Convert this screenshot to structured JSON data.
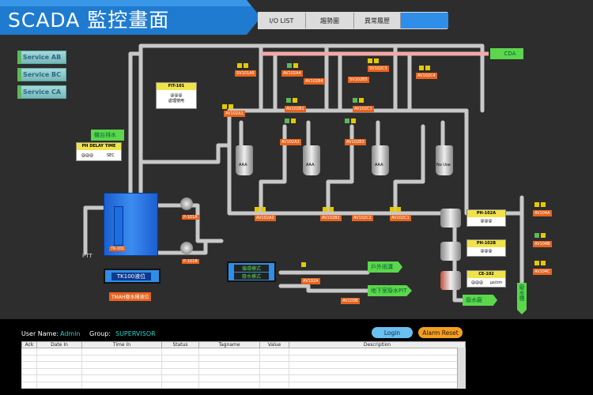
{
  "header": {
    "title": "SCADA 監控畫面",
    "nav_tabs": [
      "I/O LIST",
      "趨勢圖",
      "異常履歷"
    ]
  },
  "services": [
    "Service AB",
    "Service BC",
    "Service CA"
  ],
  "cda_label": "CDA",
  "flow_panel": {
    "title": "FIT-101",
    "value": "@@@",
    "unit": "處理使用",
    "unit2": ""
  },
  "ph_delay": {
    "title": "PH DELAY TIME",
    "value": "@@@",
    "unit": "SEC"
  },
  "machine_drain": "機台排水",
  "main_tank_label": "TK-101",
  "level_box_label": "TK100液位",
  "tmah_label": "TMAH廢水桶液位",
  "pumps": [
    "P-101A",
    "P-101B"
  ],
  "ptt_label": "PTT",
  "filter_labels": [
    "AAA",
    "AAA",
    "AAA",
    "No Use"
  ],
  "valves": {
    "top": [
      "SV101A5",
      "AV102A4",
      "AV102B4",
      "SV102B5",
      "SV102C5",
      "AV102C4"
    ],
    "mid": [
      "AV102A1",
      "AV102B1",
      "AV102C1"
    ],
    "mid2": [
      "AV102A3",
      "AV102B3",
      "AV102C3"
    ],
    "bottom": [
      "AV102A2",
      "AV102B2",
      "AV102C2",
      "AV102C1"
    ],
    "right": [
      "AV104A",
      "AV104B",
      "AV104C"
    ],
    "lower": [
      "AV102A",
      "AV103B"
    ]
  },
  "ph_a": {
    "title": "PH-102A",
    "value": "@@@"
  },
  "ph_b": {
    "title": "PH-102B",
    "value": "@@@"
  },
  "ce": {
    "title": "CE-102",
    "value": "@@@",
    "unit": "μs/cm"
  },
  "mode_box": {
    "line1": "循環模式",
    "line2": "廢水模式"
  },
  "outdoor_rain": "戶外雨溝",
  "underground": "地下室廢水PIT",
  "waste_pool": "廢水廠",
  "waste_tank_v": "廢水槽",
  "bottom": {
    "user_name_label": "User Name:",
    "user_name": "Admin",
    "group_label": "Group:",
    "group": "SUPERVISOR",
    "login": "Login",
    "alarm_reset": "Alarm Reset",
    "columns": [
      "Ack",
      "Date In",
      "Time In",
      "Status",
      "Tagname",
      "Value",
      "Description"
    ]
  },
  "colors": {
    "accent": "#1e7bd0",
    "pipe": "#c8c8c8",
    "hot_pipe": "#f4a8a8",
    "valve_label": "#e8641e",
    "tag_green": "#5cd64c"
  }
}
